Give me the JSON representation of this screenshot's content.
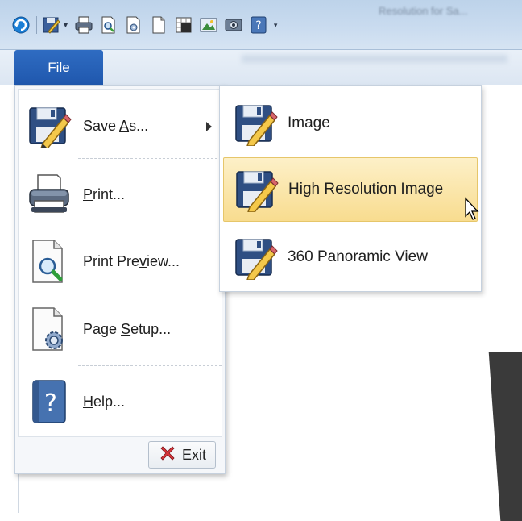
{
  "window": {
    "title": "Resolution for Sa..."
  },
  "quick_access": {
    "icons": [
      "app-logo-icon",
      "save-as-icon",
      "print-icon",
      "print-preview-icon",
      "page-setup-icon",
      "new-page-icon",
      "grid-view-icon",
      "image-export-icon",
      "panorama-icon",
      "help-icon"
    ]
  },
  "ribbon": {
    "file_tab_label": "File"
  },
  "file_menu": {
    "items": [
      {
        "label_pre": "Save ",
        "label_u": "A",
        "label_post": "s...",
        "icon": "save-as-icon",
        "has_submenu": true
      },
      {
        "label_pre": "",
        "label_u": "P",
        "label_post": "rint...",
        "icon": "printer-icon"
      },
      {
        "label_pre": "Print Pre",
        "label_u": "v",
        "label_post": "iew...",
        "icon": "print-preview-icon"
      },
      {
        "label_pre": "Page ",
        "label_u": "S",
        "label_post": "etup...",
        "icon": "page-setup-icon"
      },
      {
        "label_pre": "",
        "label_u": "H",
        "label_post": "elp...",
        "icon": "help-icon"
      }
    ],
    "exit": {
      "label_u": "E",
      "label_post": "xit",
      "icon": "close-x-icon"
    }
  },
  "save_as_submenu": {
    "items": [
      {
        "label": "Image",
        "icon": "save-image-icon"
      },
      {
        "label": "High Resolution Image",
        "icon": "save-hires-icon",
        "highlighted": true
      },
      {
        "label": "360 Panoramic View",
        "icon": "save-panorama-icon"
      }
    ]
  },
  "colors": {
    "accent": "#2562b8",
    "highlight": "#f8dc8f",
    "ribbon": "#dce6f2"
  }
}
